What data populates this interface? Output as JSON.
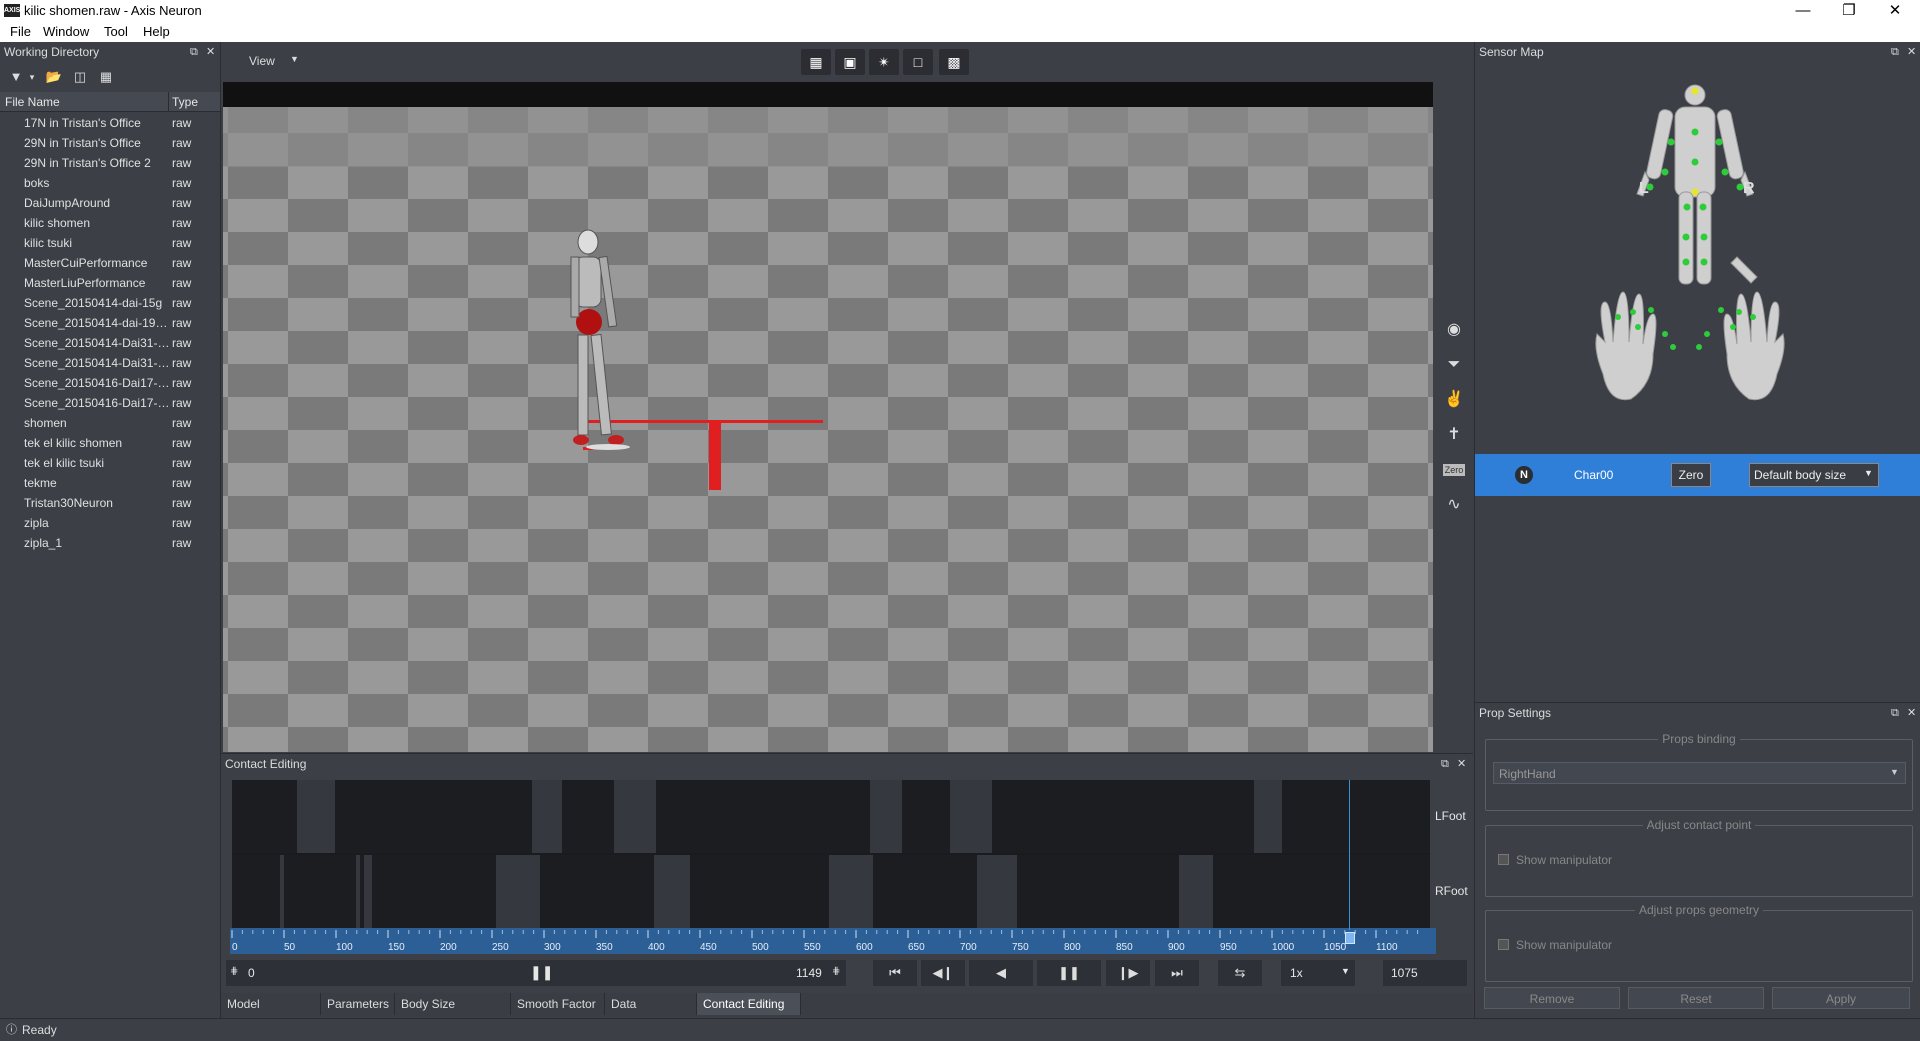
{
  "window": {
    "title": "kilic shomen.raw - Axis Neuron",
    "app_icon": "AXIS"
  },
  "menu": [
    "File",
    "Window",
    "Tool",
    "Help"
  ],
  "working_directory": {
    "title": "Working Directory",
    "columns": {
      "name": "File Name",
      "type": "Type"
    },
    "files": [
      {
        "name": "17N in Tristan's Office",
        "type": "raw"
      },
      {
        "name": "29N in Tristan's Office",
        "type": "raw"
      },
      {
        "name": "29N in Tristan's Office 2",
        "type": "raw"
      },
      {
        "name": "boks",
        "type": "raw"
      },
      {
        "name": "DaiJumpAround",
        "type": "raw"
      },
      {
        "name": "kilic shomen",
        "type": "raw"
      },
      {
        "name": "kilic tsuki",
        "type": "raw"
      },
      {
        "name": "MasterCuiPerformance",
        "type": "raw"
      },
      {
        "name": "MasterLiuPerformance",
        "type": "raw"
      },
      {
        "name": "Scene_20150414-dai-15g",
        "type": "raw"
      },
      {
        "name": "Scene_20150414-dai-19-f...",
        "type": "raw"
      },
      {
        "name": "Scene_20150414-Dai31-01g",
        "type": "raw"
      },
      {
        "name": "Scene_20150414-Dai31-02g",
        "type": "raw"
      },
      {
        "name": "Scene_20150416-Dai17-1...",
        "type": "raw"
      },
      {
        "name": "Scene_20150416-Dai17-1...",
        "type": "raw"
      },
      {
        "name": "shomen",
        "type": "raw"
      },
      {
        "name": "tek el kilic shomen",
        "type": "raw"
      },
      {
        "name": "tek el kilic tsuki",
        "type": "raw"
      },
      {
        "name": "tekme",
        "type": "raw"
      },
      {
        "name": "Tristan30Neuron",
        "type": "raw"
      },
      {
        "name": "zipla",
        "type": "raw"
      },
      {
        "name": "zipla_1",
        "type": "raw"
      }
    ]
  },
  "viewport": {
    "view_label": "View"
  },
  "side_tools": [
    "record-icon",
    "ground-icon",
    "hand-icon",
    "tpose-icon",
    "zero-icon",
    "smooth-icon"
  ],
  "side_zero_label": "Zero",
  "contact_editing": {
    "title": "Contact Editing",
    "tracks": [
      "LFoot",
      "RFoot"
    ],
    "ticks": [
      "0",
      "50",
      "100",
      "150",
      "200",
      "250",
      "300",
      "350",
      "400",
      "450",
      "500",
      "550",
      "600",
      "650",
      "700",
      "750",
      "800",
      "850",
      "900",
      "950",
      "1000",
      "1050",
      "1100"
    ],
    "range_start": "0",
    "range_end": "1149",
    "speed": "1x",
    "frame": "1075"
  },
  "bottom_tabs": [
    "Model Alignment",
    "Parameters",
    "Body Size Manager",
    "Smooth Factor",
    "Data Visualizer",
    "Contact Editing"
  ],
  "active_tab": "Contact Editing",
  "sensor_map": {
    "title": "Sensor Map",
    "left_label": "L",
    "right_label": "R",
    "char_badge": "N",
    "char_name": "Char00",
    "zero_label": "Zero",
    "body_size": "Default body size"
  },
  "prop_settings": {
    "title": "Prop Settings",
    "binding_title": "Props binding",
    "binding_value": "RightHand",
    "contact_title": "Adjust contact point",
    "contact_check": "Show manipulator",
    "geometry_title": "Adjust props geometry",
    "geometry_check": "Show manipulator",
    "buttons": [
      "Remove",
      "Reset",
      "Apply"
    ]
  },
  "status": "Ready",
  "colors": {
    "accent": "#2f7fd9",
    "sensor_green": "#2ecc3a",
    "sensor_yellow": "#e6e62b",
    "red_marker": "#e02020"
  }
}
